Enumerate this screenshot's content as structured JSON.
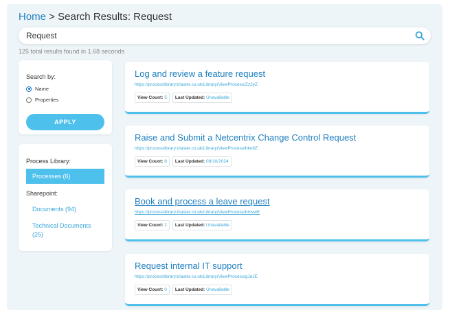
{
  "breadcrumb": {
    "home": "Home",
    "separator": " > ",
    "current": "Search Results: Request"
  },
  "search": {
    "value": "Request",
    "icon": "search-icon"
  },
  "results_summary": "125 total results found in 1.68 seconds",
  "search_panel": {
    "title": "Search by:",
    "options": [
      {
        "label": "Name",
        "checked": true
      },
      {
        "label": "Properties",
        "checked": false
      }
    ],
    "apply_label": "APPLY"
  },
  "library_panel": {
    "process_library_title": "Process Library:",
    "processes_label": "Processes (6)",
    "sharepoint_title": "Sharepoint:",
    "documents_label": "Documents (94)",
    "technical_documents_label": "Technical Documents (25)"
  },
  "colors": {
    "accent": "#4ec0ec",
    "link": "#1e7fc0",
    "background": "#eef5f9"
  },
  "results": [
    {
      "title": "Log and review a feature request",
      "url": "https://processlibrary.triaster.co.uk/Library/ViewProcess/Zz2yZ",
      "view_count_label": "View Count:",
      "view_count": "5",
      "last_updated_label": "Last Updated:",
      "last_updated": "Unavailable"
    },
    {
      "title": "Raise and Submit a Netcentrix Change Control Request",
      "url": "https://processlibrary.triaster.co.uk/Library/ViewProcess/bkn8Z",
      "view_count_label": "View Count:",
      "view_count": "8",
      "last_updated_label": "Last Updated:",
      "last_updated": "08/10/2024"
    },
    {
      "title": "Book and process a leave request",
      "url": "https://processlibrary.triaster.co.uk/Library/ViewProcess/bmvwE",
      "view_count_label": "View Count:",
      "view_count": "2",
      "last_updated_label": "Last Updated:",
      "last_updated": "Unavailable"
    },
    {
      "title": "Request internal IT support",
      "url": "https://processlibrary.triaster.co.uk/Library/ViewProcess/gJeJE",
      "view_count_label": "View Count:",
      "view_count": "0",
      "last_updated_label": "Last Updated:",
      "last_updated": "Unavailable"
    }
  ]
}
